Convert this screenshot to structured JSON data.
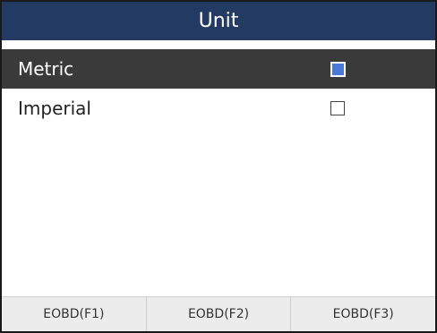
{
  "header": {
    "title": "Unit"
  },
  "units": {
    "items": [
      {
        "label": "Metric",
        "checked": true
      },
      {
        "label": "Imperial",
        "checked": false
      }
    ]
  },
  "footer": {
    "buttons": [
      "EOBD(F1)",
      "EOBD(F2)",
      "EOBD(F3)"
    ]
  },
  "colors": {
    "header_bg": "#233a63",
    "selected_row_bg": "#3a3a3a",
    "checkbox_checked": "#4a79d8",
    "footer_bg": "#ececec"
  }
}
